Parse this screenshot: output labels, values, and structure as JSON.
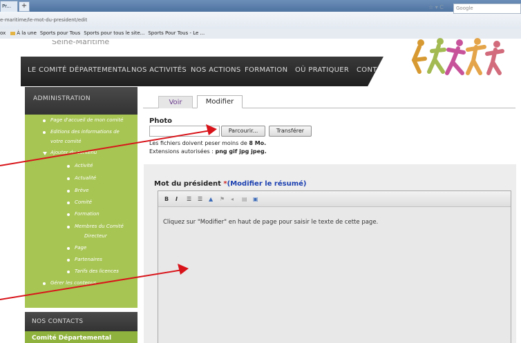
{
  "browser": {
    "tab_label": "Pr...",
    "new_tab": "+",
    "url": "e-maritime/le-mot-du-president/edit",
    "search_engine": "Google",
    "bookmarks": [
      "ox",
      "À la une",
      "Sports pour Tous",
      "Sports pour tous le site...",
      "Sports Pour Tous - Le ..."
    ]
  },
  "header": {
    "site_name": "Seine-Maritime",
    "nav": [
      "LE COMITÉ DÉPARTEMENTAL",
      "NOS ACTIVITÉS",
      "NOS ACTIONS",
      "FORMATION",
      "OÙ PRATIQUER",
      "CONTACTS"
    ]
  },
  "sidebar": {
    "title": "ADMINISTRATION",
    "items": [
      {
        "label": "Page d'accueil de mon comité"
      },
      {
        "label": "Editions des informations de"
      },
      {
        "label": "votre comité"
      },
      {
        "label": "Ajouter du contenu"
      },
      {
        "label": "Activité"
      },
      {
        "label": "Actualité"
      },
      {
        "label": "Brève"
      },
      {
        "label": "Comité"
      },
      {
        "label": "Formation"
      },
      {
        "label": "Membres du Comité"
      },
      {
        "label": "Directeur"
      },
      {
        "label": "Page"
      },
      {
        "label": "Partenaires"
      },
      {
        "label": "Tarifs des licences"
      },
      {
        "label": "Gérer les contenus"
      }
    ],
    "contacts_title": "NOS CONTACTS",
    "contacts_text": "Comité Départemental"
  },
  "main": {
    "tabs": [
      {
        "label": "Voir"
      },
      {
        "label": "Modifier"
      }
    ],
    "photo_label": "Photo",
    "browse_label": "Parcourir...",
    "upload_label": "Transférer",
    "help_size_prefix": "Les fichiers doivent peser moins de ",
    "help_size_value": "8 Mo.",
    "help_ext_prefix": "Extensions autorisées : ",
    "help_ext_value": "png gif jpg jpeg.",
    "mdp_label": "Mot du président ",
    "mdp_required": "*",
    "mdp_link": "(Modifier le résumé)",
    "toolbar": [
      "B",
      "I",
      "☰",
      "☰",
      "▲",
      "⚑",
      "◂",
      "▤",
      "▣"
    ],
    "editor_text": "Cliquez sur \"Modifier\" en haut de page pour saisir le texte de cette page."
  },
  "colors": {
    "sidebar_green": "#a7c553",
    "arrow_red": "#d8141a",
    "nav_dark": "#2a2a2a",
    "tab_purple": "#6b3b8f"
  }
}
